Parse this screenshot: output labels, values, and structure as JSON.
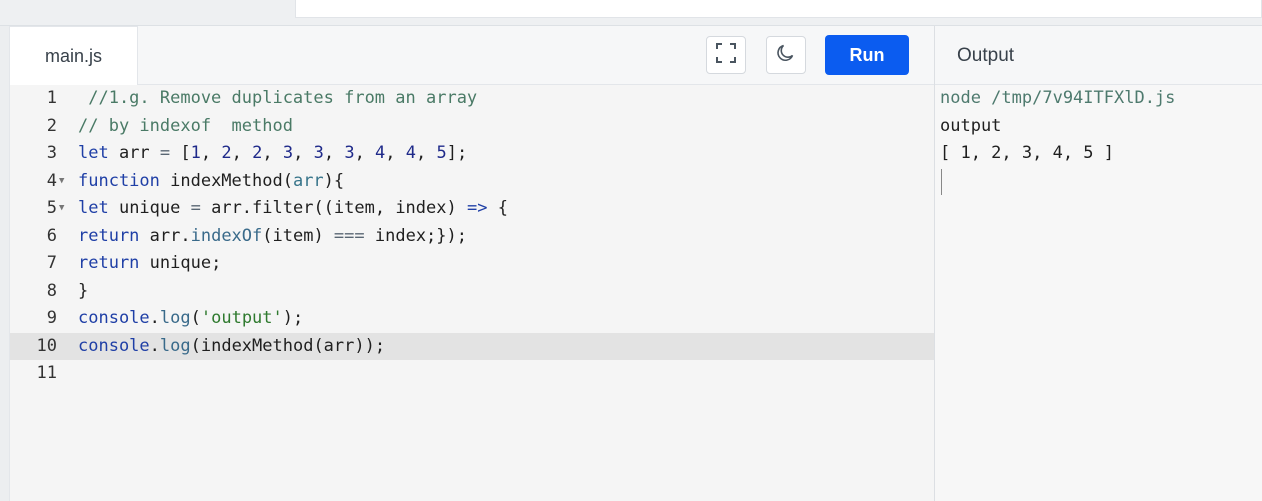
{
  "editor": {
    "tab_label": "main.js",
    "run_label": "Run",
    "lines": [
      {
        "num": "1",
        "fold": "",
        "tokens": [
          {
            "t": " //1.g. Remove duplicates from an array",
            "c": "comment"
          }
        ]
      },
      {
        "num": "2",
        "fold": "",
        "tokens": [
          {
            "t": "// by indexof  method",
            "c": "comment"
          }
        ]
      },
      {
        "num": "3",
        "fold": "",
        "tokens": [
          {
            "t": "let",
            "c": "kw"
          },
          {
            "t": " arr ",
            "c": ""
          },
          {
            "t": "=",
            "c": "op"
          },
          {
            "t": " [",
            "c": ""
          },
          {
            "t": "1",
            "c": "num"
          },
          {
            "t": ", ",
            "c": ""
          },
          {
            "t": "2",
            "c": "num"
          },
          {
            "t": ", ",
            "c": ""
          },
          {
            "t": "2",
            "c": "num"
          },
          {
            "t": ", ",
            "c": ""
          },
          {
            "t": "3",
            "c": "num"
          },
          {
            "t": ", ",
            "c": ""
          },
          {
            "t": "3",
            "c": "num"
          },
          {
            "t": ", ",
            "c": ""
          },
          {
            "t": "3",
            "c": "num"
          },
          {
            "t": ", ",
            "c": ""
          },
          {
            "t": "4",
            "c": "num"
          },
          {
            "t": ", ",
            "c": ""
          },
          {
            "t": "4",
            "c": "num"
          },
          {
            "t": ", ",
            "c": ""
          },
          {
            "t": "5",
            "c": "num"
          },
          {
            "t": "];",
            "c": ""
          }
        ]
      },
      {
        "num": "4",
        "fold": "▼",
        "tokens": [
          {
            "t": "function",
            "c": "kw"
          },
          {
            "t": " indexMethod(",
            "c": ""
          },
          {
            "t": "arr",
            "c": "param"
          },
          {
            "t": "){",
            "c": ""
          }
        ]
      },
      {
        "num": "5",
        "fold": "▼",
        "tokens": [
          {
            "t": "let",
            "c": "kw"
          },
          {
            "t": " unique ",
            "c": ""
          },
          {
            "t": "=",
            "c": "op"
          },
          {
            "t": " arr.filter((item, index) ",
            "c": ""
          },
          {
            "t": "=>",
            "c": "kw"
          },
          {
            "t": " {",
            "c": ""
          }
        ]
      },
      {
        "num": "6",
        "fold": "",
        "tokens": [
          {
            "t": "return",
            "c": "kw"
          },
          {
            "t": " arr.",
            "c": ""
          },
          {
            "t": "indexOf",
            "c": "prop"
          },
          {
            "t": "(item) ",
            "c": ""
          },
          {
            "t": "===",
            "c": "op"
          },
          {
            "t": " index;});",
            "c": ""
          }
        ]
      },
      {
        "num": "7",
        "fold": "",
        "tokens": [
          {
            "t": "return",
            "c": "kw"
          },
          {
            "t": " unique;",
            "c": ""
          }
        ]
      },
      {
        "num": "8",
        "fold": "",
        "tokens": [
          {
            "t": "}",
            "c": ""
          }
        ]
      },
      {
        "num": "9",
        "fold": "",
        "tokens": [
          {
            "t": "console",
            "c": "kw"
          },
          {
            "t": ".",
            "c": ""
          },
          {
            "t": "log",
            "c": "prop"
          },
          {
            "t": "(",
            "c": ""
          },
          {
            "t": "'output'",
            "c": "str"
          },
          {
            "t": ");",
            "c": ""
          }
        ]
      },
      {
        "num": "10",
        "fold": "",
        "active": true,
        "tokens": [
          {
            "t": "console",
            "c": "kw"
          },
          {
            "t": ".",
            "c": ""
          },
          {
            "t": "log",
            "c": "prop"
          },
          {
            "t": "(indexMethod(arr));",
            "c": ""
          }
        ]
      },
      {
        "num": "11",
        "fold": "",
        "tokens": []
      }
    ]
  },
  "output": {
    "title": "Output",
    "lines": [
      {
        "text": "node /tmp/7v94ITFXlD.js",
        "kind": "cmd"
      },
      {
        "text": "output",
        "kind": "out"
      },
      {
        "text": "[ 1, 2, 3, 4, 5 ]",
        "kind": "out"
      }
    ]
  },
  "icons": {
    "fullscreen": "fullscreen-icon",
    "theme": "moon-icon"
  },
  "colors": {
    "run_button": "#0b5cf0",
    "code_bg": "#f5f5f5",
    "active_line": "#e3e3e3"
  }
}
